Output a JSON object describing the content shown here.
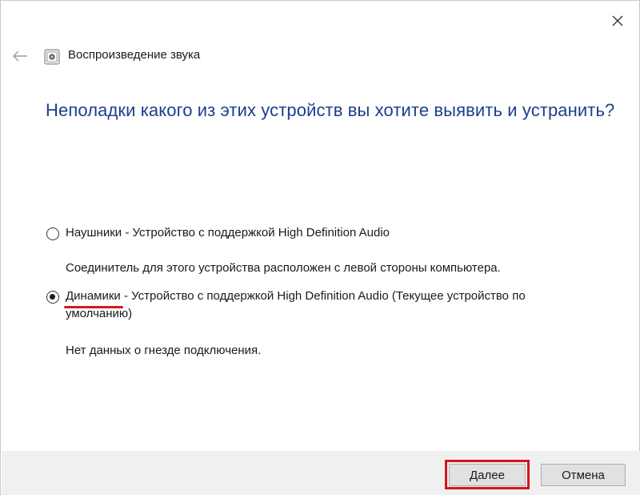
{
  "window": {
    "close_icon": "close-icon"
  },
  "header": {
    "back_icon": "back-arrow-icon",
    "app_icon": "sound-troubleshooter-icon",
    "title": "Воспроизведение звука"
  },
  "main": {
    "heading": "Неполадки какого из этих устройств вы хотите выявить и устранить?",
    "options": [
      {
        "name": "Наушники",
        "description": " - Устройство с поддержкой High Definition Audio",
        "hint": "Соединитель для этого устройства расположен с левой стороны компьютера.",
        "selected": false
      },
      {
        "name": "Динамики",
        "description_line1": " - Устройство с поддержкой High Definition Audio (Текущее устройство по",
        "description_line2": "умолчанию)",
        "hint": "Нет данных о гнезде подключения.",
        "selected": true
      }
    ]
  },
  "footer": {
    "next_label": "Далее",
    "cancel_label": "Отмена"
  },
  "colors": {
    "heading": "#1c3f8c",
    "highlight": "#d4141b",
    "footer_bg": "#f0f0f0"
  }
}
